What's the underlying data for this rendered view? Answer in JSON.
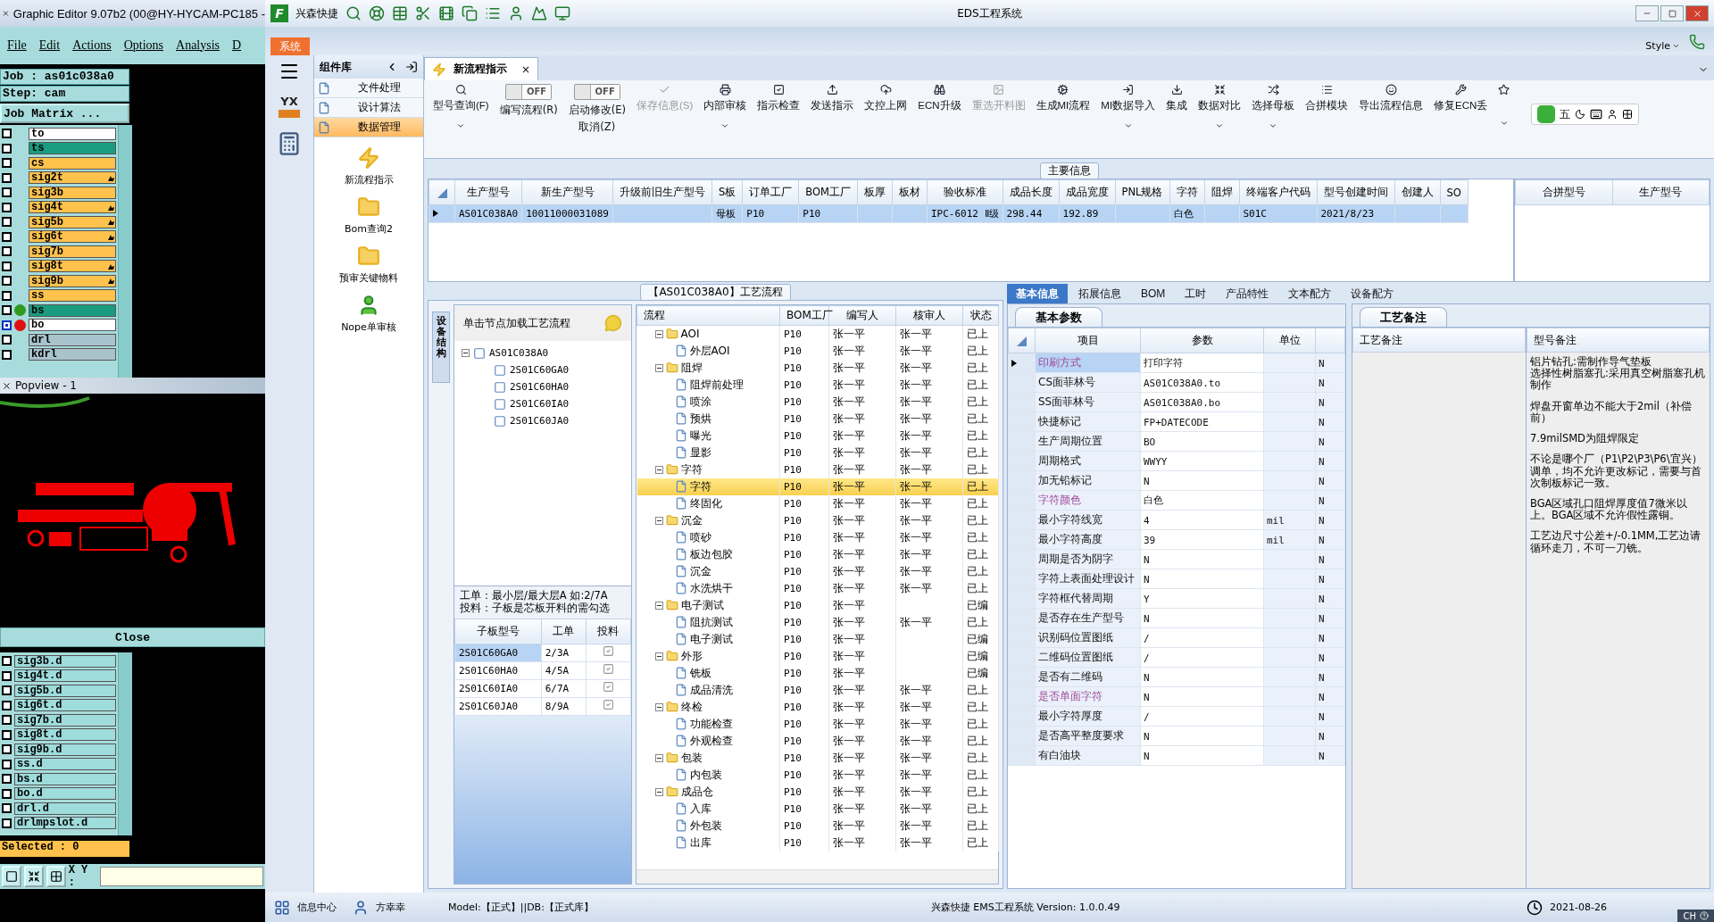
{
  "editor": {
    "title": "Graphic Editor 9.07b2 (00@HY-HYCAM-PC185 -",
    "menu": [
      "File",
      "Edit",
      "Actions",
      "Options",
      "Analysis",
      "D"
    ],
    "job": "Job : as01c038a0",
    "step": "Step: cam",
    "matrix_button": "Job Matrix ...",
    "layers": [
      {
        "name": "to",
        "color": "#ffffff",
        "flagged": false,
        "selected": false
      },
      {
        "name": "ts",
        "color": "#1a9c80",
        "flagged": false,
        "selected": false
      },
      {
        "name": "cs",
        "color": "#ffc24d",
        "flagged": false,
        "selected": false
      },
      {
        "name": "sig2t",
        "color": "#ffc24d",
        "flagged": true,
        "selected": false
      },
      {
        "name": "sig3b",
        "color": "#ffc24d",
        "flagged": false,
        "selected": false
      },
      {
        "name": "sig4t",
        "color": "#ffc24d",
        "flagged": true,
        "selected": false
      },
      {
        "name": "sig5b",
        "color": "#ffc24d",
        "flagged": true,
        "selected": false
      },
      {
        "name": "sig6t",
        "color": "#ffc24d",
        "flagged": true,
        "selected": false
      },
      {
        "name": "sig7b",
        "color": "#ffc24d",
        "flagged": false,
        "selected": false
      },
      {
        "name": "sig8t",
        "color": "#ffc24d",
        "flagged": true,
        "selected": false
      },
      {
        "name": "sig9b",
        "color": "#ffc24d",
        "flagged": true,
        "selected": false
      },
      {
        "name": "ss",
        "color": "#ffc24d",
        "flagged": false,
        "selected": false
      },
      {
        "name": "bs",
        "color": "#1a9c80",
        "flagged": false,
        "selected": false,
        "marker": {
          "color": "#2e9a1e"
        }
      },
      {
        "name": "bo",
        "color": "#ffffff",
        "flagged": false,
        "selected": true,
        "marker": {
          "color": "#e01010"
        }
      },
      {
        "name": "drl",
        "color": "#a9c3cc",
        "flagged": false,
        "selected": false
      },
      {
        "name": "kdrl",
        "color": "#a9c3cc",
        "flagged": false,
        "selected": false
      }
    ],
    "popview": {
      "title": "Popview - 1",
      "close": "Close"
    },
    "drill_layers": [
      {
        "name": "sig3b.d",
        "selected": false
      },
      {
        "name": "sig4t.d",
        "selected": false
      },
      {
        "name": "sig5b.d",
        "selected": false
      },
      {
        "name": "sig6t.d",
        "selected": false
      },
      {
        "name": "sig7b.d",
        "selected": false
      },
      {
        "name": "sig8t.d",
        "selected": false
      },
      {
        "name": "sig9b.d",
        "selected": false
      },
      {
        "name": "ss.d",
        "selected": false
      },
      {
        "name": "bs.d",
        "selected": false
      },
      {
        "name": "bo.d",
        "selected": false
      },
      {
        "name": "drl.d",
        "selected": false
      },
      {
        "name": "drlmpslot.d",
        "selected": false
      }
    ],
    "selected_count": "Selected : 0",
    "xy_label": "X Y :"
  },
  "app": {
    "logo": "F",
    "company": "兴森快捷",
    "title": "EDS工程系统",
    "system_tab": "系统",
    "style_menu": "Style",
    "strip_logo": "YX",
    "components": {
      "title": "组件库",
      "items": [
        {
          "label": "文件处理",
          "selected": false
        },
        {
          "label": "设计算法",
          "selected": false
        },
        {
          "label": "数据管理",
          "selected": true
        }
      ],
      "tools": [
        "新流程指示",
        "Bom查询2",
        "预审关键物料",
        "Nope单审核"
      ]
    },
    "doc_tab": {
      "label": "新流程指示",
      "close": "×"
    },
    "toolbar": [
      {
        "kind": "button",
        "label": "型号查询(F)",
        "dropdown": true,
        "disabled": false
      },
      {
        "kind": "toggle",
        "label": "编写流程(R)",
        "toggle_text": "OFF",
        "on": false
      },
      {
        "kind": "toggle",
        "label": "启动修改(E)",
        "label2": "取消(Z)",
        "toggle_text": "OFF",
        "on": false
      },
      {
        "kind": "button",
        "label": "保存信息(S)",
        "dropdown": false,
        "disabled": true
      },
      {
        "kind": "button",
        "label": "内部审核",
        "dropdown": true,
        "disabled": false
      },
      {
        "kind": "button",
        "label": "指示检查",
        "dropdown": false,
        "disabled": false
      },
      {
        "kind": "button",
        "label": "发送指示",
        "dropdown": false,
        "disabled": false
      },
      {
        "kind": "button",
        "label": "文控上网",
        "dropdown": false,
        "disabled": false
      },
      {
        "kind": "button",
        "label": "ECN升级",
        "dropdown": false,
        "disabled": false
      },
      {
        "kind": "button",
        "label": "重选开料图",
        "dropdown": false,
        "disabled": true
      },
      {
        "kind": "button",
        "label": "生成MI流程",
        "dropdown": false,
        "disabled": false
      },
      {
        "kind": "button",
        "label": "MI数据导入",
        "dropdown": true,
        "disabled": false
      },
      {
        "kind": "button",
        "label": "集成",
        "dropdown": false,
        "disabled": false
      },
      {
        "kind": "button",
        "label": "数据对比",
        "dropdown": true,
        "disabled": false
      },
      {
        "kind": "button",
        "label": "选择母板",
        "dropdown": true,
        "disabled": false
      },
      {
        "kind": "button",
        "label": "合拼模块",
        "dropdown": false,
        "disabled": false
      },
      {
        "kind": "button",
        "label": "导出流程信息",
        "dropdown": false,
        "disabled": false
      },
      {
        "kind": "button",
        "label": "修复ECN丢",
        "dropdown": false,
        "disabled": false
      },
      {
        "kind": "button",
        "dropdown": true,
        "disabled": false
      }
    ],
    "ime": {
      "mode": "五",
      "language": "CH"
    },
    "main_info": {
      "title": "主要信息",
      "columns": [
        {
          "label": "生产型号",
          "value": "AS01C038A0"
        },
        {
          "label": "新生产型号",
          "value": "10011000031089"
        },
        {
          "label": "升级前旧生产型号"
        },
        {
          "label": "S板",
          "value": "母板"
        },
        {
          "label": "订单工厂",
          "value": "P10"
        },
        {
          "label": "BOM工厂",
          "value": "P10"
        },
        {
          "label": "板厚"
        },
        {
          "label": "板材"
        },
        {
          "label": "验收标准",
          "value": "IPC-6012 Ⅱ级"
        },
        {
          "label": "成品长度",
          "value": "298.44"
        },
        {
          "label": "成品宽度",
          "value": "192.89"
        },
        {
          "label": "PNL规格"
        },
        {
          "label": "字符",
          "value": "白色"
        },
        {
          "label": "阻焊"
        },
        {
          "label": "终端客户代码",
          "value": "S01C"
        },
        {
          "label": "型号创建时间",
          "value": "2021/8/23"
        },
        {
          "label": "创建人"
        },
        {
          "label": "SO"
        }
      ],
      "row_selected": true,
      "merge_columns": [
        "合拼型号",
        "生产型号"
      ]
    },
    "process": {
      "title": "【AS01C038A0】工艺流程",
      "side_tab": "设备结构",
      "hint": "单击节点加载工艺流程",
      "board_tree": {
        "label": "AS01C038A0",
        "expanded": true,
        "children": [
          "2S01C60GA0",
          "2S01C60HA0",
          "2S01C60IA0",
          "2S01C60JA0"
        ]
      },
      "note": "工单：最小层/最大层A 如:2/7A\n投料：子板是芯板开料的需勾选",
      "sub_columns": [
        "子板型号",
        "工单",
        "投料"
      ],
      "sub_rows": [
        {
          "model": "2S01C60GA0",
          "order": "2/3A",
          "checked": true,
          "selected": true
        },
        {
          "model": "2S01C60HA0",
          "order": "4/5A",
          "checked": true,
          "selected": false
        },
        {
          "model": "2S01C60IA0",
          "order": "6/7A",
          "checked": true,
          "selected": false
        },
        {
          "model": "2S01C60JA0",
          "order": "8/9A",
          "checked": true,
          "selected": false
        }
      ],
      "columns": [
        "流程",
        "BOM工厂",
        "编写人",
        "核审人",
        "状态"
      ],
      "steps": [
        {
          "name": "AOI",
          "bom": "P10",
          "writer": "张一平",
          "reviewer": "张一平",
          "status": "已上",
          "selected": false,
          "expanded": true,
          "children": [
            {
              "name": "外层AOI",
              "bom": "P10",
              "writer": "张一平",
              "reviewer": "张一平",
              "status": "已上",
              "selected": false
            }
          ]
        },
        {
          "name": "阻焊",
          "bom": "P10",
          "writer": "张一平",
          "reviewer": "张一平",
          "status": "已上",
          "selected": false,
          "expanded": true,
          "children": [
            {
              "name": "阻焊前处理",
              "bom": "P10",
              "writer": "张一平",
              "reviewer": "张一平",
              "status": "已上",
              "selected": false
            },
            {
              "name": "喷涂",
              "bom": "P10",
              "writer": "张一平",
              "reviewer": "张一平",
              "status": "已上",
              "selected": false
            },
            {
              "name": "预烘",
              "bom": "P10",
              "writer": "张一平",
              "reviewer": "张一平",
              "status": "已上",
              "selected": false
            },
            {
              "name": "曝光",
              "bom": "P10",
              "writer": "张一平",
              "reviewer": "张一平",
              "status": "已上",
              "selected": false
            },
            {
              "name": "显影",
              "bom": "P10",
              "writer": "张一平",
              "reviewer": "张一平",
              "status": "已上",
              "selected": false
            }
          ]
        },
        {
          "name": "字符",
          "bom": "P10",
          "writer": "张一平",
          "reviewer": "张一平",
          "status": "已上",
          "selected": false,
          "expanded": true,
          "children": [
            {
              "name": "字符",
              "bom": "P10",
              "writer": "张一平",
              "reviewer": "张一平",
              "status": "已上",
              "selected": true
            },
            {
              "name": "终固化",
              "bom": "P10",
              "writer": "张一平",
              "reviewer": "张一平",
              "status": "已上",
              "selected": false
            }
          ]
        },
        {
          "name": "沉金",
          "bom": "P10",
          "writer": "张一平",
          "reviewer": "张一平",
          "status": "已上",
          "selected": false,
          "expanded": true,
          "children": [
            {
              "name": "喷砂",
              "bom": "P10",
              "writer": "张一平",
              "reviewer": "张一平",
              "status": "已上",
              "selected": false
            },
            {
              "name": "板边包胶",
              "bom": "P10",
              "writer": "张一平",
              "reviewer": "张一平",
              "status": "已上",
              "selected": false
            },
            {
              "name": "沉金",
              "bom": "P10",
              "writer": "张一平",
              "reviewer": "张一平",
              "status": "已上",
              "selected": false
            },
            {
              "name": "水洗烘干",
              "bom": "P10",
              "writer": "张一平",
              "reviewer": "张一平",
              "status": "已上",
              "selected": false
            }
          ]
        },
        {
          "name": "电子测试",
          "bom": "P10",
          "writer": "张一平",
          "status": "已编",
          "selected": false,
          "expanded": true,
          "children": [
            {
              "name": "阻抗测试",
              "bom": "P10",
              "writer": "张一平",
              "reviewer": "张一平",
              "status": "已上",
              "selected": false
            },
            {
              "name": "电子测试",
              "bom": "P10",
              "writer": "张一平",
              "status": "已编",
              "selected": false
            }
          ]
        },
        {
          "name": "外形",
          "bom": "P10",
          "writer": "张一平",
          "status": "已编",
          "selected": false,
          "expanded": true,
          "children": [
            {
              "name": "铣板",
              "bom": "P10",
              "writer": "张一平",
              "status": "已编",
              "selected": false
            },
            {
              "name": "成品清洗",
              "bom": "P10",
              "writer": "张一平",
              "reviewer": "张一平",
              "status": "已上",
              "selected": false
            }
          ]
        },
        {
          "name": "终检",
          "bom": "P10",
          "writer": "张一平",
          "reviewer": "张一平",
          "status": "已上",
          "selected": false,
          "expanded": true,
          "children": [
            {
              "name": "功能检查",
              "bom": "P10",
              "writer": "张一平",
              "reviewer": "张一平",
              "status": "已上",
              "selected": false
            },
            {
              "name": "外观检查",
              "bom": "P10",
              "writer": "张一平",
              "reviewer": "张一平",
              "status": "已上",
              "selected": false
            }
          ]
        },
        {
          "name": "包装",
          "bom": "P10",
          "writer": "张一平",
          "reviewer": "张一平",
          "status": "已上",
          "selected": false,
          "expanded": true,
          "children": [
            {
              "name": "内包装",
              "bom": "P10",
              "writer": "张一平",
              "reviewer": "张一平",
              "status": "已上",
              "selected": false
            }
          ]
        },
        {
          "name": "成品仓",
          "bom": "P10",
          "writer": "张一平",
          "reviewer": "张一平",
          "status": "已上",
          "selected": false,
          "expanded": true,
          "children": [
            {
              "name": "入库",
              "bom": "P10",
              "writer": "张一平",
              "reviewer": "张一平",
              "status": "已上",
              "selected": false
            },
            {
              "name": "外包装",
              "bom": "P10",
              "writer": "张一平",
              "reviewer": "张一平",
              "status": "已上",
              "selected": false
            },
            {
              "name": "出库",
              "bom": "P10",
              "writer": "张一平",
              "reviewer": "张一平",
              "status": "已上",
              "selected": false
            }
          ]
        }
      ]
    },
    "detail": {
      "tabs": [
        {
          "label": "基本信息",
          "selected": true
        },
        {
          "label": "拓展信息",
          "selected": false
        },
        {
          "label": "BOM",
          "selected": false
        },
        {
          "label": "工时",
          "selected": false
        },
        {
          "label": "产品特性",
          "selected": false
        },
        {
          "label": "文本配方",
          "selected": false
        },
        {
          "label": "设备配方",
          "selected": false
        }
      ],
      "params_tab": "基本参数",
      "notes_tab": "工艺备注",
      "param_columns": [
        "项目",
        "参数",
        "单位"
      ],
      "params": [
        {
          "item": "印刷方式",
          "value": "打印字符",
          "flag": "N",
          "highlight": true,
          "selected": true
        },
        {
          "item": "CS面菲林号",
          "value": "AS01C038A0.to",
          "flag": "N",
          "highlight": false,
          "selected": false
        },
        {
          "item": "SS面菲林号",
          "value": "AS01C038A0.bo",
          "flag": "N",
          "highlight": false,
          "selected": false
        },
        {
          "item": "快捷标记",
          "value": "FP+DATECODE",
          "flag": "N",
          "highlight": false,
          "selected": false
        },
        {
          "item": "生产周期位置",
          "value": "BO",
          "flag": "N",
          "highlight": false,
          "selected": false
        },
        {
          "item": "周期格式",
          "value": "WWYY",
          "flag": "N",
          "highlight": false,
          "selected": false
        },
        {
          "item": "加无铅标记",
          "value": "N",
          "flag": "N",
          "highlight": false,
          "selected": false
        },
        {
          "item": "字符颜色",
          "value": "白色",
          "flag": "N",
          "highlight": true,
          "selected": false
        },
        {
          "item": "最小字符线宽",
          "value": "4",
          "unit": "mil",
          "flag": "N",
          "highlight": false,
          "selected": false
        },
        {
          "item": "最小字符高度",
          "value": "39",
          "unit": "mil",
          "flag": "N",
          "highlight": false,
          "selected": false
        },
        {
          "item": "周期是否为阴字",
          "value": "N",
          "flag": "N",
          "highlight": false,
          "selected": false
        },
        {
          "item": "字符上表面处理设计",
          "value": "N",
          "flag": "N",
          "highlight": false,
          "selected": false
        },
        {
          "item": "字符框代替周期",
          "value": "Y",
          "flag": "N",
          "highlight": false,
          "selected": false
        },
        {
          "item": "是否存在生产型号",
          "value": "N",
          "flag": "N",
          "highlight": false,
          "selected": false
        },
        {
          "item": "识别码位置图纸",
          "value": "/",
          "flag": "N",
          "highlight": false,
          "selected": false
        },
        {
          "item": "二维码位置图纸",
          "value": "/",
          "flag": "N",
          "highlight": false,
          "selected": false
        },
        {
          "item": "是否有二维码",
          "value": "N",
          "flag": "N",
          "highlight": false,
          "selected": false
        },
        {
          "item": "是否单面字符",
          "value": "N",
          "flag": "N",
          "highlight": true,
          "selected": false
        },
        {
          "item": "最小字符厚度",
          "value": "/",
          "flag": "N",
          "highlight": false,
          "selected": false
        },
        {
          "item": "是否高平整度要求",
          "value": "N",
          "flag": "N",
          "highlight": false,
          "selected": false
        },
        {
          "item": "有白油块",
          "value": "N",
          "flag": "N",
          "highlight": false,
          "selected": false
        }
      ],
      "note_columns": [
        "工艺备注",
        "型号备注"
      ],
      "model_notes": [
        [
          "铝片钻孔:需制作导气垫板",
          "选择性树脂塞孔:采用真空树脂塞孔机制作"
        ],
        [
          "焊盘开窗单边不能大于2mil（补偿前）"
        ],
        [
          "7.9milSMD为阻焊限定"
        ],
        [
          "不论是哪个厂（P1\\P2\\P3\\P6\\宜兴）调单，均不允许更改标记，需要与首次制板标记一致。"
        ],
        [
          "BGA区域孔口阻焊厚度值7微米以上。BGA区域不允许假性露铜。"
        ],
        [
          "工艺边尺寸公差+/-0.1MM,工艺边请循环走刀，不可一刀铣。"
        ]
      ]
    },
    "status_bar": {
      "info_center": "信息中心",
      "user": "方幸幸",
      "model": "Model:【正式】||DB:【正式库】",
      "version": "兴森快捷 EMS工程系统 Version: 1.0.0.49",
      "date": "2021-08-26"
    }
  }
}
